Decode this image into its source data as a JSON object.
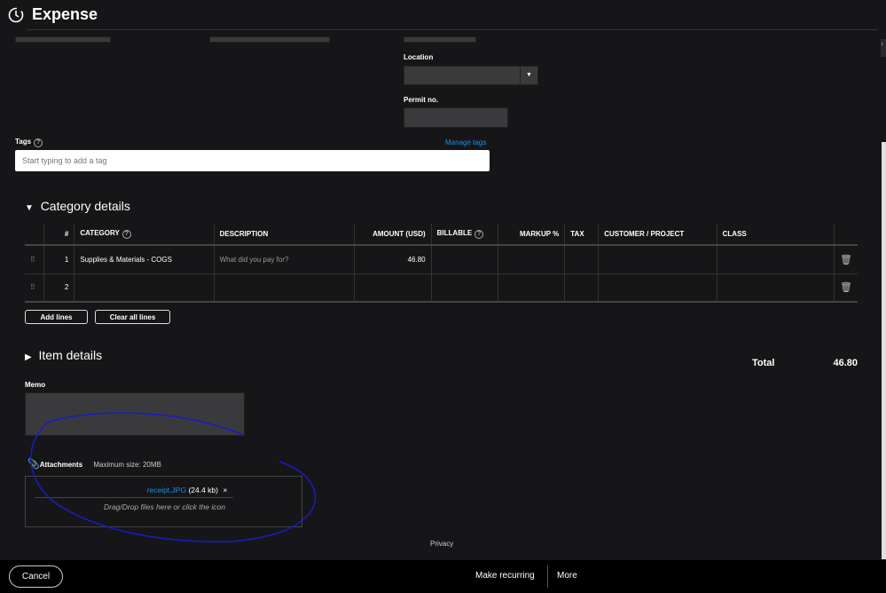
{
  "header": {
    "title": "Expense"
  },
  "form": {
    "location_label": "Location",
    "permit_label": "Permit no.",
    "tags_label": "Tags",
    "manage_tags": "Manage tags",
    "tags_placeholder": "Start typing to add a tag"
  },
  "category": {
    "title": "Category details",
    "columns": [
      "#",
      "CATEGORY",
      "DESCRIPTION",
      "AMOUNT (USD)",
      "BILLABLE",
      "MARKUP %",
      "TAX",
      "CUSTOMER / PROJECT",
      "CLASS"
    ],
    "rows": [
      {
        "num": "1",
        "category": "Supplies & Materials - COGS",
        "description": "What did you pay for?",
        "amount": "46.80"
      },
      {
        "num": "2",
        "category": "",
        "description": "",
        "amount": ""
      }
    ],
    "add_lines": "Add lines",
    "clear_lines": "Clear all lines"
  },
  "items": {
    "title": "Item details"
  },
  "total": {
    "label": "Total",
    "value": "46.80"
  },
  "memo": {
    "label": "Memo"
  },
  "attachments": {
    "label": "Attachments",
    "max_size": "Maximum size: 20MB",
    "file_name": "receipt.JPG",
    "file_size": "(24.4 kb)",
    "remove": "×",
    "drop_hint": "Drag/Drop files here or click the icon"
  },
  "privacy": "Privacy",
  "footer": {
    "cancel": "Cancel",
    "make_recurring": "Make recurring",
    "more": "More"
  }
}
